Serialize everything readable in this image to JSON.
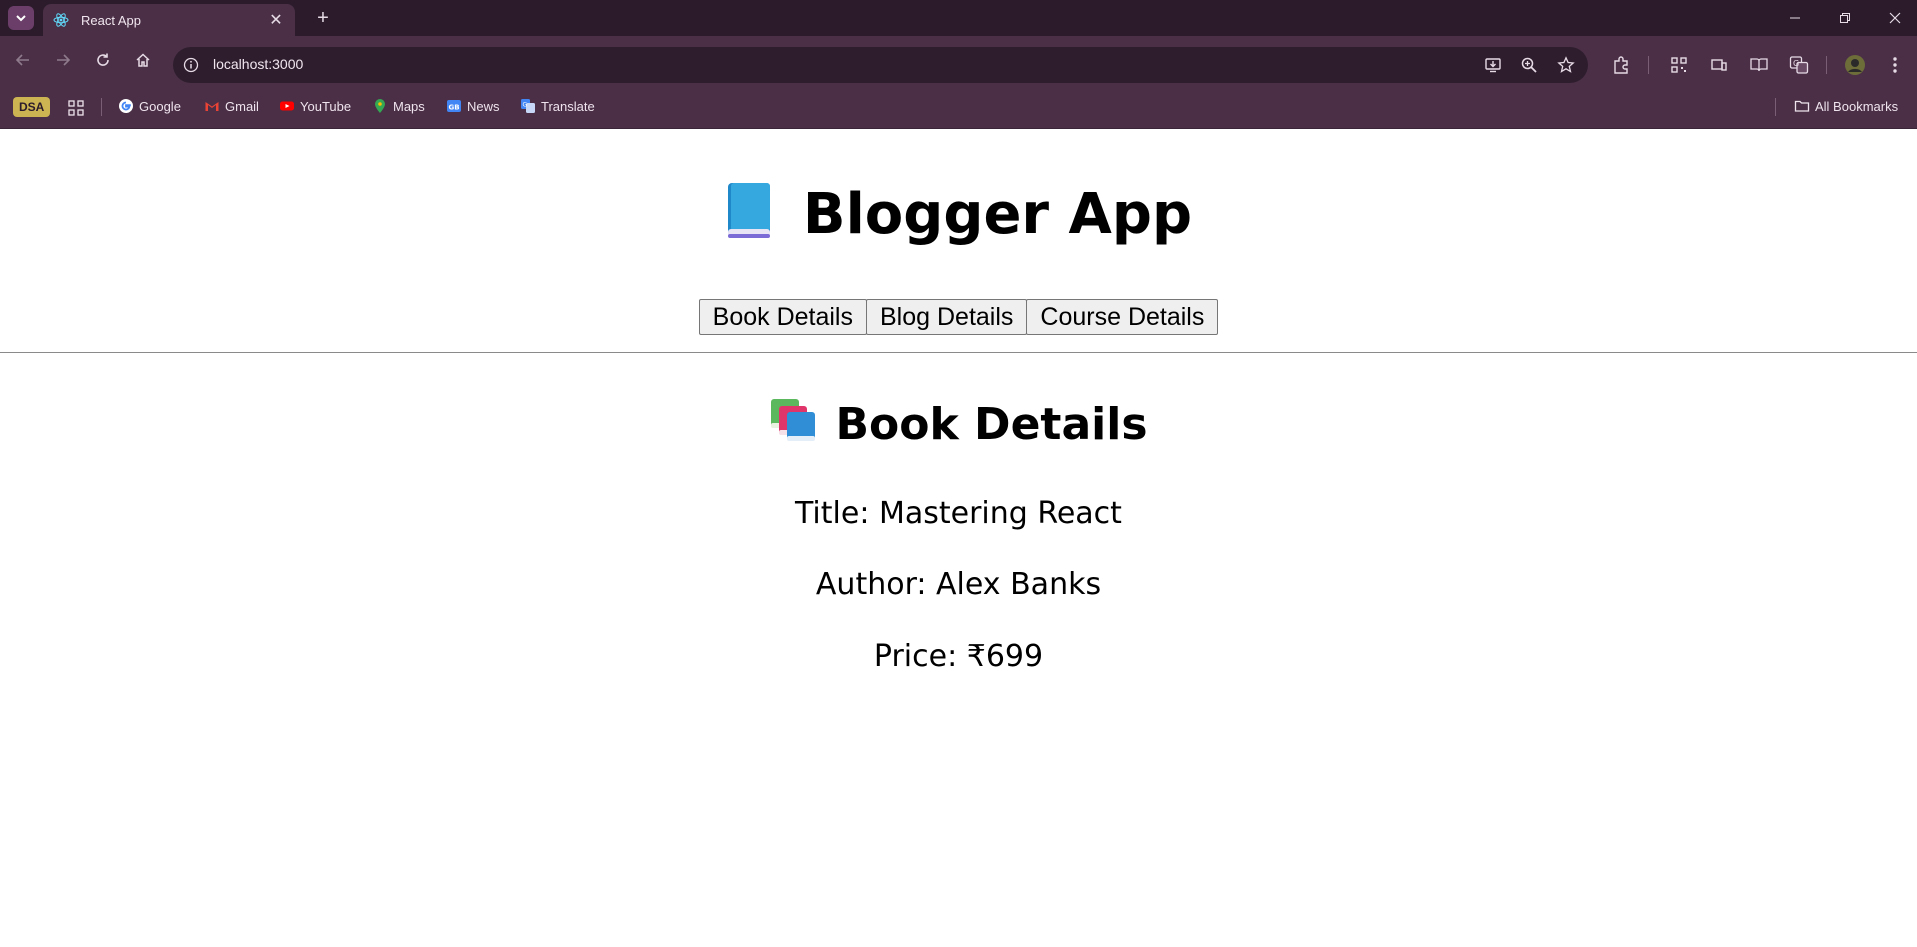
{
  "browser": {
    "tab_title": "React App",
    "url": "localhost:3000",
    "bookmarks": [
      {
        "label": "DSA"
      },
      {
        "label": "Google"
      },
      {
        "label": "Gmail"
      },
      {
        "label": "YouTube"
      },
      {
        "label": "Maps"
      },
      {
        "label": "News"
      },
      {
        "label": "Translate"
      }
    ],
    "all_bookmarks": "All Bookmarks"
  },
  "app": {
    "title": "Blogger App",
    "nav": [
      {
        "label": "Book Details"
      },
      {
        "label": "Blog Details"
      },
      {
        "label": "Course Details"
      }
    ]
  },
  "book": {
    "heading": "Book Details",
    "title": "Title: Mastering React",
    "author": "Author: Alex Banks",
    "price": "Price: ₹699"
  },
  "colors": {
    "chrome_dark": "#2b1b2b",
    "chrome": "#4a2f46",
    "omnibox": "#2e1d2d"
  }
}
